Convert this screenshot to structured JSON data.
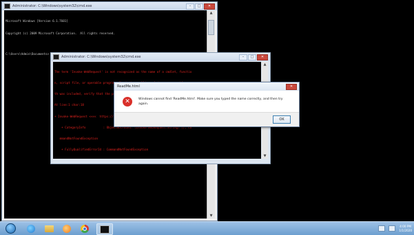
{
  "back_console": {
    "title": "Administrator: C:\\Windows\\system32\\cmd.exe",
    "lines": [
      "Microsoft Windows [Version 6.1.7601]",
      "Copyright (c) 2009 Microsoft Corporation.  All rights reserved.",
      "",
      "C:\\Users\\Admin\\Documents>"
    ]
  },
  "middle_console": {
    "title": "Administrator: C:\\Windows\\system32\\cmd.exe",
    "lines": [
      "The term 'Invoke-WebRequest' is not recognized as the name of a cmdlet, functio",
      "n, script file, or operable program. Check the spelling of the name, or if a pa",
      "th was included, verify that the path is correct and try again.",
      "At line:1 char:18",
      "+ Invoke-WebRequest <<<<  https://...................... -outfile ReadMe.html",
      "    + CategoryInfo          : ObjectNotFound: (Invoke-WebRequest:String) [], Co",
      "   mmandNotFoundException",
      "    + FullyQualifiedErrorId : CommandNotFoundException"
    ]
  },
  "dialog": {
    "title": "ReadMe.html",
    "message": "Windows cannot find 'ReadMe.html'. Make sure you typed the name correctly, and then try again.",
    "ok_label": "OK"
  },
  "window_buttons": {
    "minimize": "–",
    "maximize": "□",
    "close": "✕"
  },
  "taskbar": {
    "clock_time": "4:00 PM",
    "clock_date": "1/1/2020",
    "pinned": [
      "windows-start",
      "internet-explorer",
      "file-explorer",
      "media-player",
      "chrome",
      "command-prompt"
    ]
  }
}
